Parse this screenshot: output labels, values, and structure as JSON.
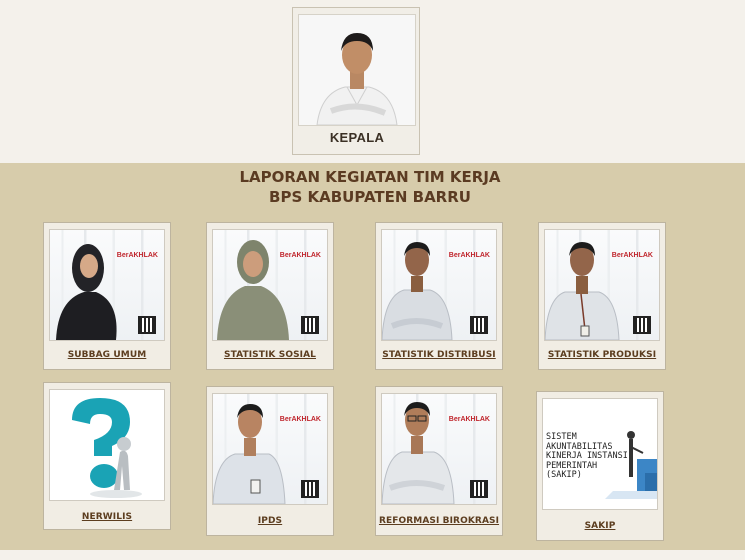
{
  "kepala": {
    "label": "KEPALA"
  },
  "heading": {
    "line1": "LAPORAN KEGIATAN TIM KERJA",
    "line2": "BPS KABUPATEN BARRU"
  },
  "badge": {
    "logo_text": "BerAKHLAK"
  },
  "teams": [
    {
      "label": "SUBBAG UMUM"
    },
    {
      "label": "STATISTIK SOSIAL"
    },
    {
      "label": "STATISTIK DISTRIBUSI"
    },
    {
      "label": "STATISTIK PRODUKSI"
    },
    {
      "label": "NERWILIS"
    },
    {
      "label": "IPDS"
    },
    {
      "label": "REFORMASI BIROKRASI"
    },
    {
      "label": "SAKIP"
    }
  ],
  "sakip_image": {
    "text": "SISTEM AKUNTABILITAS KINERJA INSTANSI PEMERINTAH (SAKIP)"
  },
  "colors": {
    "band": "#d7ccab",
    "page": "#f4f1eb",
    "title": "#5b3b22",
    "label": "#5c3d1f",
    "logo_red": "#c0262d"
  }
}
